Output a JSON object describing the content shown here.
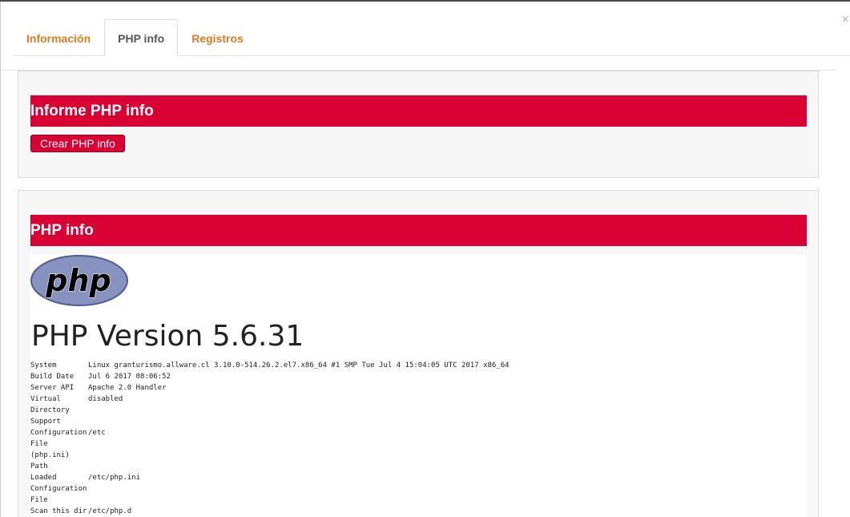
{
  "close_glyph": "×",
  "tabs": [
    {
      "label": "Información",
      "active": false
    },
    {
      "label": "PHP info",
      "active": true
    },
    {
      "label": "Registros",
      "active": false
    }
  ],
  "panel_report": {
    "title": "Informe PHP info",
    "button_label": "Crear PHP info"
  },
  "panel_phpinfo": {
    "title": "PHP info",
    "logo_text": "php",
    "version": "PHP Version 5.6.31",
    "rows": [
      {
        "key": "System",
        "value": "Linux granturismo.allware.cl 3.10.0-514.26.2.el7.x86_64 #1 SMP Tue Jul 4 15:04:05 UTC 2017 x86_64"
      },
      {
        "key": "Build Date",
        "value": "Jul 6 2017 08:06:52"
      },
      {
        "key": "Server API",
        "value": "Apache 2.0 Handler"
      },
      {
        "key": "Virtual Directory Support",
        "value": "disabled"
      },
      {
        "key": "Configuration File (php.ini) Path",
        "value": "/etc"
      },
      {
        "key": "Loaded Configuration File",
        "value": "/etc/php.ini"
      },
      {
        "key": "Scan this dir",
        "value": "/etc/php.d"
      }
    ]
  },
  "colors": {
    "accent_red": "#d90033",
    "tab_orange": "#e07b1f",
    "php_logo_purple": "#8892bf"
  }
}
